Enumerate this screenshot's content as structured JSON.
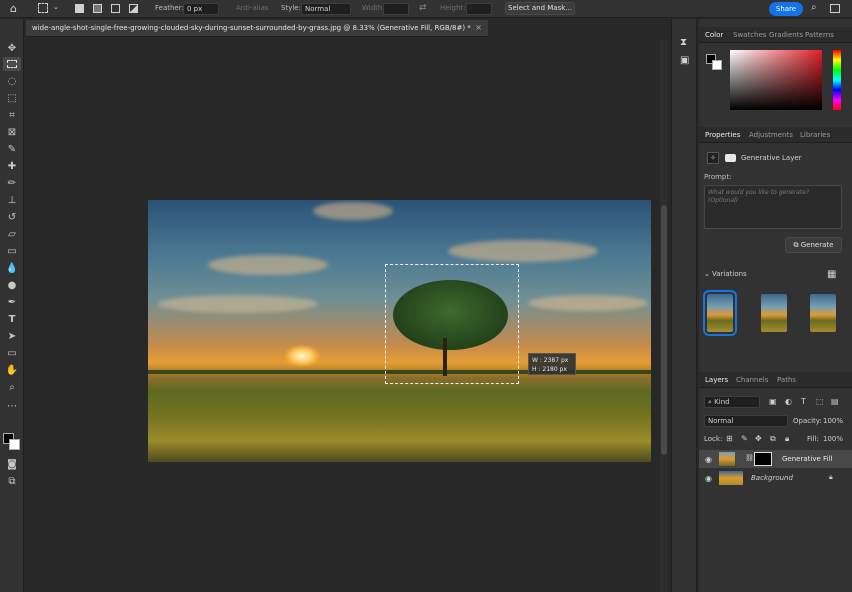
{
  "optbar": {
    "feather_label": "Feather:",
    "feather_value": "0 px",
    "antialias_label": "Anti-alias",
    "style_label": "Style:",
    "style_value": "Normal",
    "width_label": "Width:",
    "height_label": "Height:",
    "select_mask_label": "Select and Mask...",
    "share_label": "Share"
  },
  "document": {
    "tab_title": "wide-angle-shot-single-free-growing-clouded-sky-during-sunset-surrounded-by-grass.jpg @ 8.33% (Generative Fill, RGB/8#) *",
    "close": "×"
  },
  "selection_info": {
    "w_label": "W :",
    "w_value": "2387 px",
    "h_label": "H :",
    "h_value": "2180 px"
  },
  "color_panel": {
    "tabs": [
      "Color",
      "Swatches",
      "Gradients",
      "Patterns"
    ],
    "foreground": "#000000",
    "background": "#ffffff",
    "hue_color": "#e0202a"
  },
  "properties_panel": {
    "tabs": [
      "Properties",
      "Adjustments",
      "Libraries"
    ],
    "layer_type": "Generative Layer",
    "prompt_label": "Prompt:",
    "prompt_placeholder": "What would you like to generate? (Optional)",
    "generate_label": "Generate",
    "variations_label": "Variations"
  },
  "layers_panel": {
    "tabs": [
      "Layers",
      "Channels",
      "Paths"
    ],
    "kind_label": "Kind",
    "blend_mode": "Normal",
    "opacity_label": "Opacity:",
    "opacity_value": "100%",
    "lock_label": "Lock:",
    "fill_label": "Fill:",
    "fill_value": "100%",
    "layers": [
      {
        "name": "Generative Fill"
      },
      {
        "name": "Background"
      }
    ]
  },
  "colors": {
    "accent": "#1473e6",
    "panel": "#323232"
  }
}
